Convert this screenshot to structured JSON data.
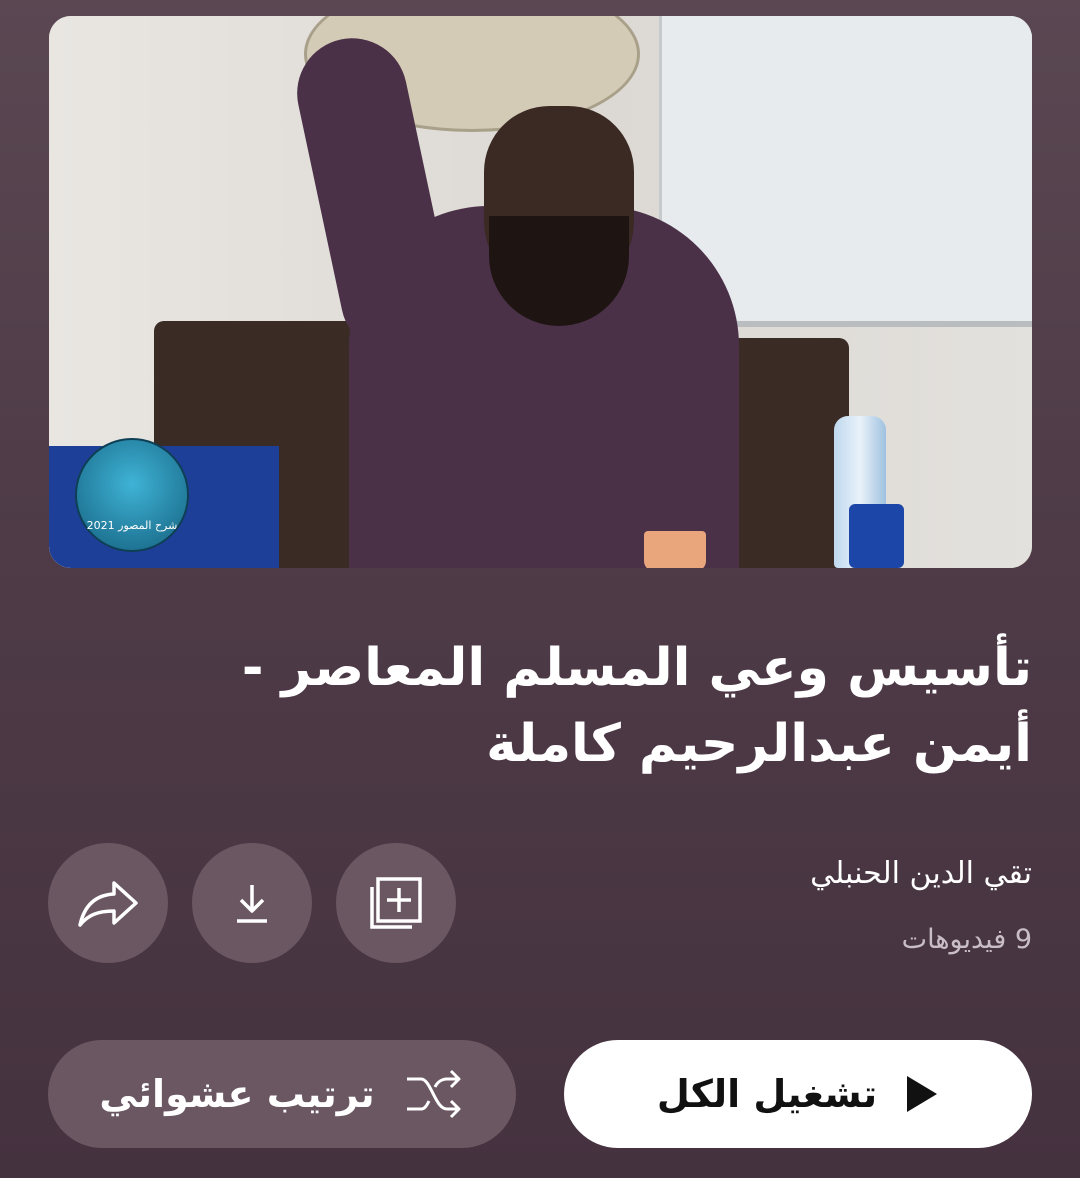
{
  "playlist": {
    "title": "تأسيس وعي المسلم المعاصر - أيمن عبدالرحيم كاملة",
    "channel": "تقي الدين الحنبلي",
    "video_count": "9 فيديوهات",
    "thumbnail_logo_text": "شرح المصور 2021"
  },
  "actions": {
    "add_to_library_icon": "library-add-icon",
    "download_icon": "download-icon",
    "share_icon": "share-icon"
  },
  "buttons": {
    "play_all": "تشغيل الكل",
    "shuffle": "ترتيب عشوائي"
  },
  "colors": {
    "background": "#4f3c48",
    "button_bg": "#6a5762",
    "primary_button_bg": "#ffffff"
  }
}
